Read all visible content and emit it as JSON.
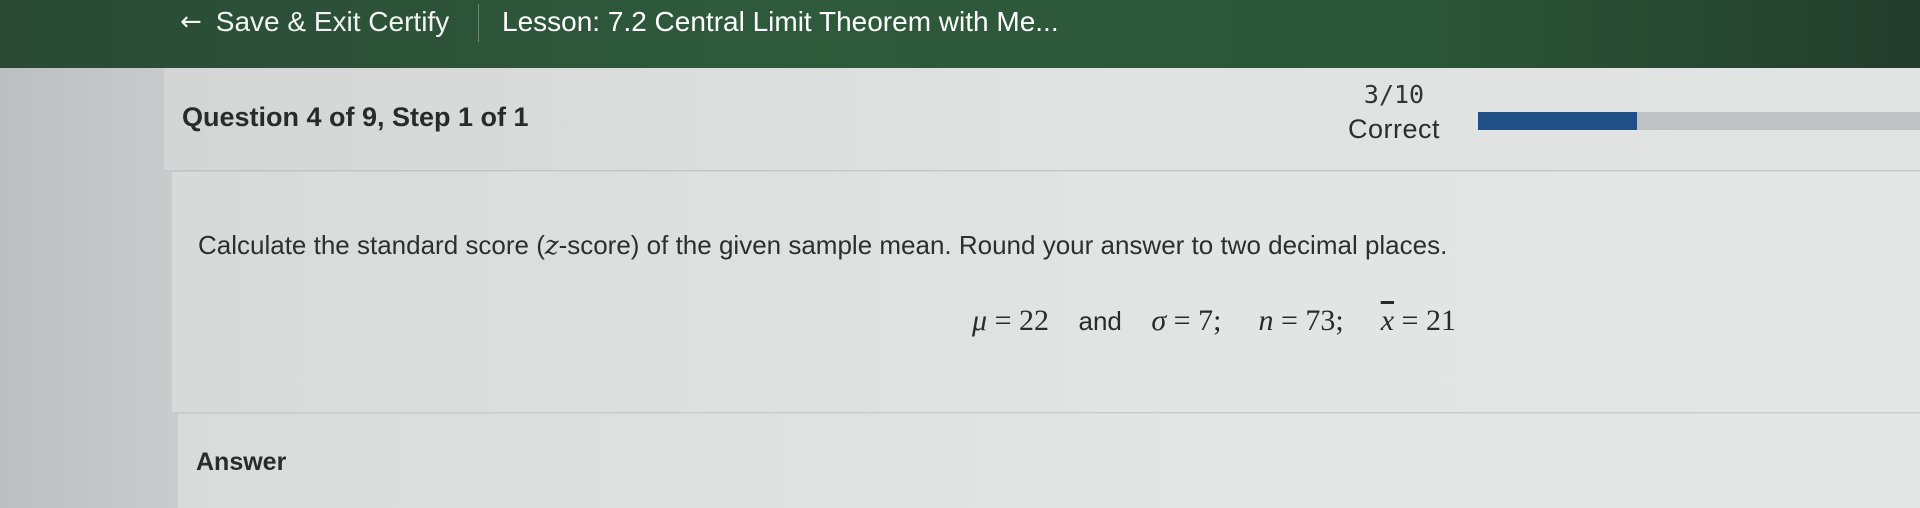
{
  "nav": {
    "back_arrow": "←",
    "back_label": "Save & Exit Certify",
    "lesson_title": "Lesson: 7.2 Central Limit Theorem with Me..."
  },
  "question": {
    "label": "Question 4 of 9, Step 1 of 1",
    "score_fraction": "3/10",
    "score_status": "Correct",
    "progress": 0.36,
    "progress_color": "#1f4f86"
  },
  "problem": {
    "prompt_before": "Calculate the standard score (",
    "prompt_var": "z",
    "prompt_after": "-score) of the given sample mean. Round your answer to two decimal places.",
    "mu_symbol": "μ",
    "mu_value": "= 22",
    "and_text": "and",
    "sigma_symbol": "σ",
    "sigma_value": "= 7;",
    "n_symbol": "n",
    "n_value": "= 73;",
    "xbar_symbol": "x",
    "xbar_value": "= 21"
  },
  "answer": {
    "label": "Answer"
  }
}
